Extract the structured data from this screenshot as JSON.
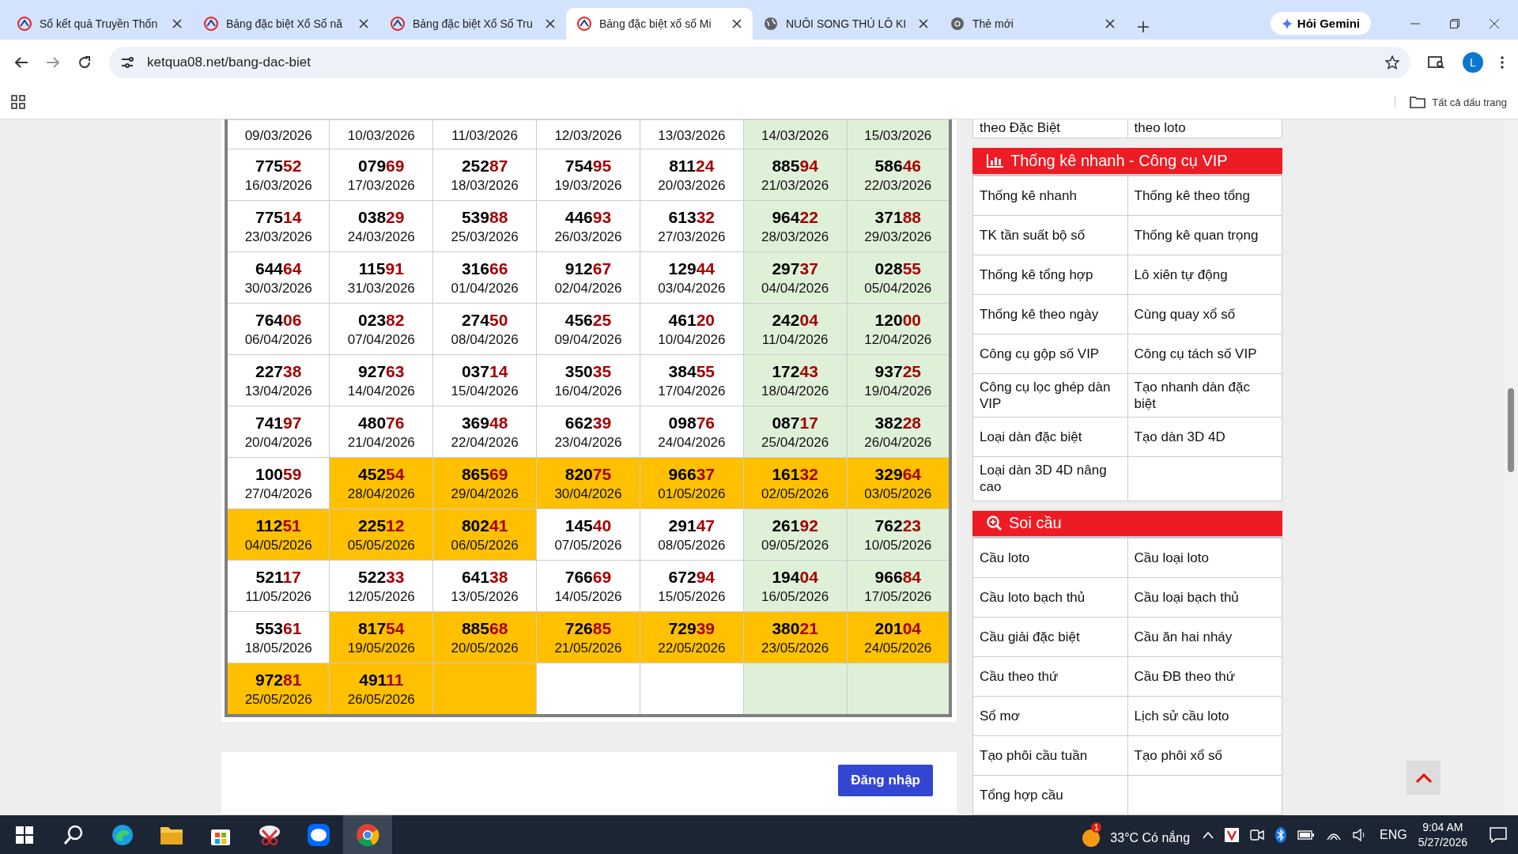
{
  "browser": {
    "tabs": [
      {
        "title": "Sổ kết quả Truyền Thốn",
        "selected": false
      },
      {
        "title": "Bảng đặc biệt Xổ Số nă",
        "selected": false
      },
      {
        "title": "Bảng đặc biệt Xổ Số Tru",
        "selected": false
      },
      {
        "title": "Bảng đặc biệt xổ số Mi",
        "selected": true
      },
      {
        "title": "NUÔI SONG THỦ LÔ KI",
        "selected": false
      },
      {
        "title": "Thẻ mới",
        "selected": false
      }
    ],
    "gemini_button": "Hỏi Gemini",
    "address": "ketqua08.net/bang-dac-biet",
    "profile_initial": "L",
    "bookmarks_label": "Tất cả dấu trang"
  },
  "table": {
    "rows": [
      [
        {
          "date": "09/03/2026",
          "weekend": false,
          "highlight": false
        },
        {
          "date": "10/03/2026",
          "weekend": false,
          "highlight": false
        },
        {
          "date": "11/03/2026",
          "weekend": false,
          "highlight": false
        },
        {
          "date": "12/03/2026",
          "weekend": false,
          "highlight": false
        },
        {
          "date": "13/03/2026",
          "weekend": false,
          "highlight": false
        },
        {
          "date": "14/03/2026",
          "weekend": true,
          "highlight": false
        },
        {
          "date": "15/03/2026",
          "weekend": true,
          "highlight": false
        }
      ],
      [
        {
          "number": "77552",
          "date": "16/03/2026",
          "weekend": false,
          "highlight": false
        },
        {
          "number": "07969",
          "date": "17/03/2026",
          "weekend": false,
          "highlight": false
        },
        {
          "number": "25287",
          "date": "18/03/2026",
          "weekend": false,
          "highlight": false
        },
        {
          "number": "75495",
          "date": "19/03/2026",
          "weekend": false,
          "highlight": false
        },
        {
          "number": "81124",
          "date": "20/03/2026",
          "weekend": false,
          "highlight": false
        },
        {
          "number": "88594",
          "date": "21/03/2026",
          "weekend": true,
          "highlight": false
        },
        {
          "number": "58646",
          "date": "22/03/2026",
          "weekend": true,
          "highlight": false
        }
      ],
      [
        {
          "number": "77514",
          "date": "23/03/2026",
          "weekend": false,
          "highlight": false
        },
        {
          "number": "03829",
          "date": "24/03/2026",
          "weekend": false,
          "highlight": false
        },
        {
          "number": "53988",
          "date": "25/03/2026",
          "weekend": false,
          "highlight": false
        },
        {
          "number": "44693",
          "date": "26/03/2026",
          "weekend": false,
          "highlight": false
        },
        {
          "number": "61332",
          "date": "27/03/2026",
          "weekend": false,
          "highlight": false
        },
        {
          "number": "96422",
          "date": "28/03/2026",
          "weekend": true,
          "highlight": false
        },
        {
          "number": "37188",
          "date": "29/03/2026",
          "weekend": true,
          "highlight": false
        }
      ],
      [
        {
          "number": "64464",
          "date": "30/03/2026",
          "weekend": false,
          "highlight": false
        },
        {
          "number": "11591",
          "date": "31/03/2026",
          "weekend": false,
          "highlight": false
        },
        {
          "number": "31666",
          "date": "01/04/2026",
          "weekend": false,
          "highlight": false
        },
        {
          "number": "91267",
          "date": "02/04/2026",
          "weekend": false,
          "highlight": false
        },
        {
          "number": "12944",
          "date": "03/04/2026",
          "weekend": false,
          "highlight": false
        },
        {
          "number": "29737",
          "date": "04/04/2026",
          "weekend": true,
          "highlight": false
        },
        {
          "number": "02855",
          "date": "05/04/2026",
          "weekend": true,
          "highlight": false
        }
      ],
      [
        {
          "number": "76406",
          "date": "06/04/2026",
          "weekend": false,
          "highlight": false
        },
        {
          "number": "02382",
          "date": "07/04/2026",
          "weekend": false,
          "highlight": false
        },
        {
          "number": "27450",
          "date": "08/04/2026",
          "weekend": false,
          "highlight": false
        },
        {
          "number": "45625",
          "date": "09/04/2026",
          "weekend": false,
          "highlight": false
        },
        {
          "number": "46120",
          "date": "10/04/2026",
          "weekend": false,
          "highlight": false
        },
        {
          "number": "24204",
          "date": "11/04/2026",
          "weekend": true,
          "highlight": false
        },
        {
          "number": "12000",
          "date": "12/04/2026",
          "weekend": true,
          "highlight": false
        }
      ],
      [
        {
          "number": "22738",
          "date": "13/04/2026",
          "weekend": false,
          "highlight": false
        },
        {
          "number": "92763",
          "date": "14/04/2026",
          "weekend": false,
          "highlight": false
        },
        {
          "number": "03714",
          "date": "15/04/2026",
          "weekend": false,
          "highlight": false
        },
        {
          "number": "35035",
          "date": "16/04/2026",
          "weekend": false,
          "highlight": false
        },
        {
          "number": "38455",
          "date": "17/04/2026",
          "weekend": false,
          "highlight": false
        },
        {
          "number": "17243",
          "date": "18/04/2026",
          "weekend": true,
          "highlight": false
        },
        {
          "number": "93725",
          "date": "19/04/2026",
          "weekend": true,
          "highlight": false
        }
      ],
      [
        {
          "number": "74197",
          "date": "20/04/2026",
          "weekend": false,
          "highlight": false
        },
        {
          "number": "48076",
          "date": "21/04/2026",
          "weekend": false,
          "highlight": false
        },
        {
          "number": "36948",
          "date": "22/04/2026",
          "weekend": false,
          "highlight": false
        },
        {
          "number": "66239",
          "date": "23/04/2026",
          "weekend": false,
          "highlight": false
        },
        {
          "number": "09876",
          "date": "24/04/2026",
          "weekend": false,
          "highlight": false
        },
        {
          "number": "08717",
          "date": "25/04/2026",
          "weekend": true,
          "highlight": false
        },
        {
          "number": "38228",
          "date": "26/04/2026",
          "weekend": true,
          "highlight": false
        }
      ],
      [
        {
          "number": "10059",
          "date": "27/04/2026",
          "weekend": false,
          "highlight": false
        },
        {
          "number": "45254",
          "date": "28/04/2026",
          "highlight": true
        },
        {
          "number": "86569",
          "date": "29/04/2026",
          "highlight": true
        },
        {
          "number": "82075",
          "date": "30/04/2026",
          "highlight": true
        },
        {
          "number": "96637",
          "date": "01/05/2026",
          "highlight": true
        },
        {
          "number": "16132",
          "date": "02/05/2026",
          "highlight": true
        },
        {
          "number": "32964",
          "date": "03/05/2026",
          "highlight": true
        }
      ],
      [
        {
          "number": "11251",
          "date": "04/05/2026",
          "highlight": true
        },
        {
          "number": "22512",
          "date": "05/05/2026",
          "highlight": true
        },
        {
          "number": "80241",
          "date": "06/05/2026",
          "highlight": true
        },
        {
          "number": "14540",
          "date": "07/05/2026",
          "weekend": false,
          "highlight": false
        },
        {
          "number": "29147",
          "date": "08/05/2026",
          "weekend": false,
          "highlight": false
        },
        {
          "number": "26192",
          "date": "09/05/2026",
          "weekend": true,
          "highlight": false
        },
        {
          "number": "76223",
          "date": "10/05/2026",
          "weekend": true,
          "highlight": false
        }
      ],
      [
        {
          "number": "52117",
          "date": "11/05/2026",
          "weekend": false,
          "highlight": false
        },
        {
          "number": "52233",
          "date": "12/05/2026",
          "weekend": false,
          "highlight": false
        },
        {
          "number": "64138",
          "date": "13/05/2026",
          "weekend": false,
          "highlight": false
        },
        {
          "number": "76669",
          "date": "14/05/2026",
          "weekend": false,
          "highlight": false
        },
        {
          "number": "67294",
          "date": "15/05/2026",
          "weekend": false,
          "highlight": false
        },
        {
          "number": "19404",
          "date": "16/05/2026",
          "weekend": true,
          "highlight": false
        },
        {
          "number": "96684",
          "date": "17/05/2026",
          "weekend": true,
          "highlight": false
        }
      ],
      [
        {
          "number": "55361",
          "date": "18/05/2026",
          "weekend": false,
          "highlight": false
        },
        {
          "number": "81754",
          "date": "19/05/2026",
          "highlight": true
        },
        {
          "number": "88568",
          "date": "20/05/2026",
          "highlight": true
        },
        {
          "number": "72685",
          "date": "21/05/2026",
          "highlight": true
        },
        {
          "number": "72939",
          "date": "22/05/2026",
          "highlight": true
        },
        {
          "number": "38021",
          "date": "23/05/2026",
          "highlight": true
        },
        {
          "number": "20104",
          "date": "24/05/2026",
          "highlight": true
        }
      ],
      [
        {
          "number": "97281",
          "date": "25/05/2026",
          "highlight": true
        },
        {
          "number": "49111",
          "date": "26/05/2026",
          "highlight": true
        },
        {
          "highlight": true
        },
        {
          "weekend": false,
          "highlight": false
        },
        {
          "weekend": false,
          "highlight": false
        },
        {
          "weekend": true,
          "highlight": false
        },
        {
          "weekend": true,
          "highlight": false
        }
      ]
    ]
  },
  "login_button": "Đăng nhập",
  "sidebar": {
    "top_items": [
      "theo Đặc Biệt",
      "theo loto"
    ],
    "sections": [
      {
        "title": "Thống kê nhanh - Công cụ VIP",
        "items": [
          "Thống kê nhanh",
          "Thống kê theo tổng",
          "TK tần suất bộ số",
          "Thống kê quan trọng",
          "Thống kê tổng hợp",
          "Lô xiên tự động",
          "Thống kê theo ngày",
          "Cùng quay xổ số",
          "Công cụ gộp số VIP",
          "Công cụ tách số VIP",
          "Công cụ lọc ghép dàn VIP",
          "Tạo nhanh dàn đặc biệt",
          "Loại dàn đặc biệt",
          "Tạo dàn 3D 4D",
          "Loại dàn 3D 4D nâng cao"
        ]
      },
      {
        "title": "Soi cầu",
        "items": [
          "Cầu loto",
          "Cầu loại loto",
          "Cầu loto bạch thủ",
          "Cầu loại bạch thủ",
          "Cầu giải đặc biệt",
          "Cầu ăn hai nháy",
          "Cầu theo thứ",
          "Cầu ĐB theo thứ",
          "Sổ mơ",
          "Lịch sử cầu loto",
          "Tạo phôi cầu tuần",
          "Tạo phôi xổ số",
          "Tổng hợp cầu"
        ]
      }
    ]
  },
  "taskbar": {
    "weather": "33°C Có nắng",
    "weather_badge": "1",
    "language": "ENG",
    "time": "9:04 AM",
    "date": "5/27/2026"
  }
}
